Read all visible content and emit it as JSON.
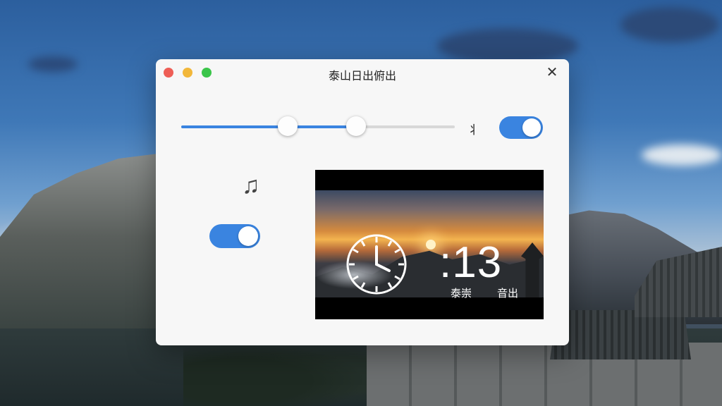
{
  "window": {
    "title": "泰山日出俯出"
  },
  "controls": {
    "slider": {
      "low_value_percent": 39,
      "high_value_percent": 64
    },
    "slider_side_label": "⺦",
    "top_toggle_on": true,
    "left_toggle_on": true
  },
  "video": {
    "time_text": ":13",
    "caption_left": "泰崇",
    "caption_right": "音出"
  },
  "colors": {
    "accent": "#3a84e0",
    "window_bg": "#f7f7f7"
  }
}
